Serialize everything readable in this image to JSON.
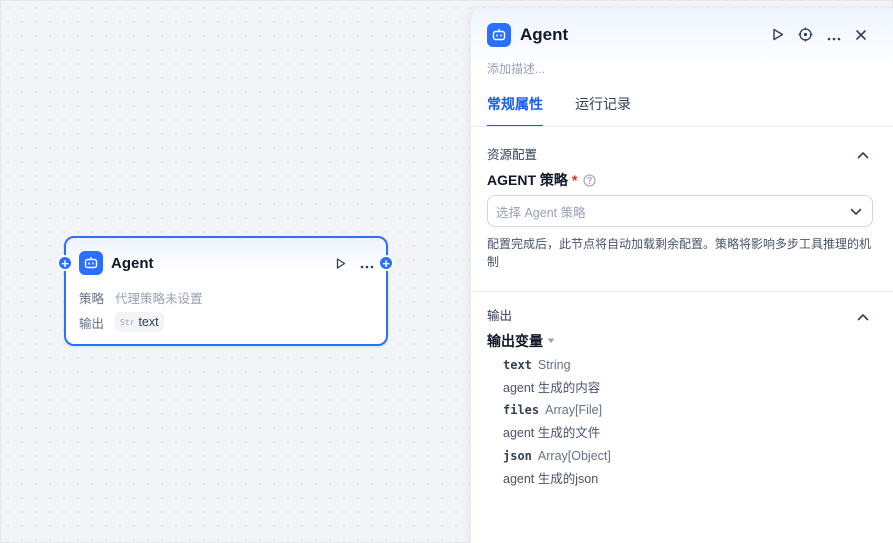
{
  "node": {
    "title": "Agent",
    "strategy_key": "策略",
    "strategy_value": "代理策略未设置",
    "output_key": "输出",
    "output_type": "Str",
    "output_name": "text"
  },
  "panel": {
    "title": "Agent",
    "description_placeholder": "添加描述...",
    "tabs": [
      {
        "label": "常规属性",
        "active": true
      },
      {
        "label": "运行记录",
        "active": false
      }
    ],
    "resource_section": {
      "title": "资源配置",
      "field_label": "AGENT 策略",
      "required_mark": "*",
      "select_placeholder": "选择 Agent 策略",
      "hint": "配置完成后，此节点将自动加载剩余配置。策略将影响多步工具推理的机制"
    },
    "output_section": {
      "title": "输出",
      "vars_label": "输出变量",
      "vars": [
        {
          "name": "text",
          "type": "String",
          "desc": "agent 生成的内容"
        },
        {
          "name": "files",
          "type": "Array[File]",
          "desc": "agent 生成的文件"
        },
        {
          "name": "json",
          "type": "Array[Object]",
          "desc": "agent 生成的json"
        }
      ]
    }
  },
  "colors": {
    "accent": "#2970ff",
    "tab_active": "#155eef",
    "required": "#d92d20"
  }
}
